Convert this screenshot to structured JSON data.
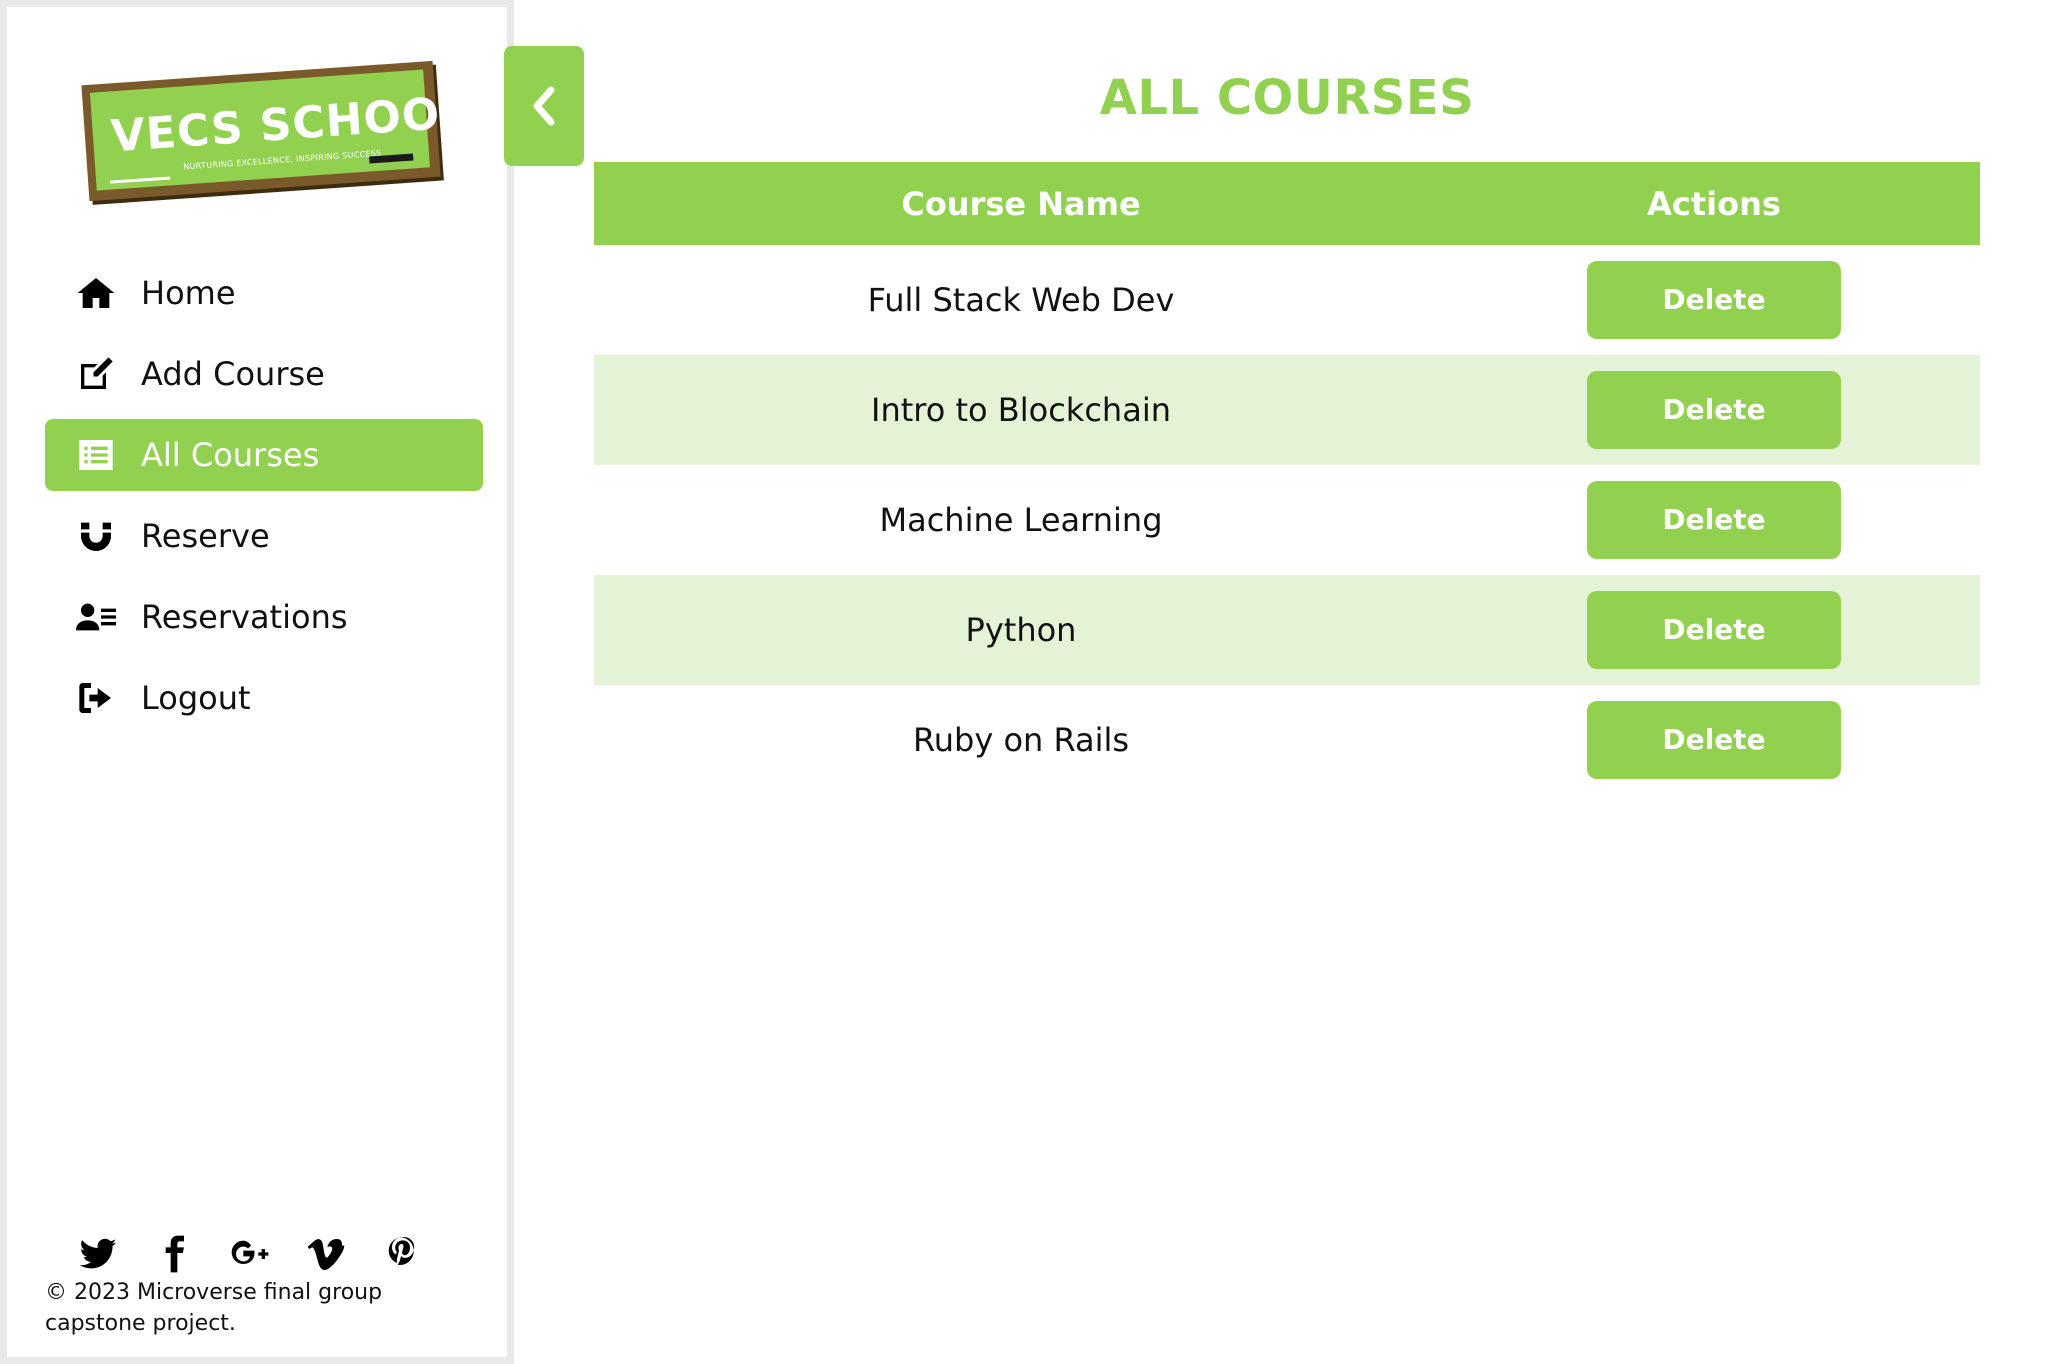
{
  "brand": {
    "title": "VECS SCHOOL",
    "tagline": "NURTURING EXCELLENCE, INSPIRING SUCCESS",
    "accent": "#92d050"
  },
  "sidebar": {
    "items": [
      {
        "label": "Home",
        "icon": "home-icon",
        "active": false
      },
      {
        "label": "Add Course",
        "icon": "edit-icon",
        "active": false
      },
      {
        "label": "All Courses",
        "icon": "list-icon",
        "active": true
      },
      {
        "label": "Reserve",
        "icon": "magnet-icon",
        "active": false
      },
      {
        "label": "Reservations",
        "icon": "user-list-icon",
        "active": false
      },
      {
        "label": "Logout",
        "icon": "logout-icon",
        "active": false
      }
    ],
    "social": [
      "twitter-icon",
      "facebook-icon",
      "google-plus-icon",
      "vimeo-icon",
      "pinterest-icon"
    ],
    "copyright": "© 2023 Microverse final group capstone project."
  },
  "main": {
    "title": "ALL COURSES",
    "table": {
      "headers": {
        "name": "Course Name",
        "actions": "Actions"
      },
      "rows": [
        {
          "name": "Full Stack Web Dev",
          "action": "Delete"
        },
        {
          "name": "Intro to Blockchain",
          "action": "Delete"
        },
        {
          "name": "Machine Learning",
          "action": "Delete"
        },
        {
          "name": "Python",
          "action": "Delete"
        },
        {
          "name": "Ruby on Rails",
          "action": "Delete"
        }
      ]
    }
  }
}
